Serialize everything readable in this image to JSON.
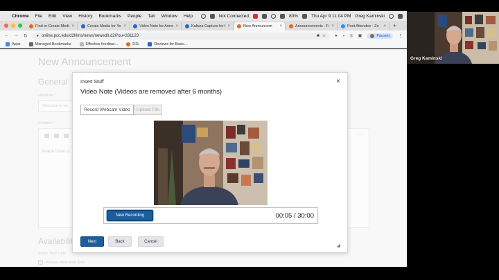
{
  "menubar": {
    "app": "Chrome",
    "items": [
      "File",
      "Edit",
      "View",
      "History",
      "Bookmarks",
      "People",
      "Tab",
      "Window",
      "Help"
    ],
    "status": "Not Connected",
    "battery": "80%",
    "datetime": "Thu Apr 9 11:04 PM",
    "user": "Greg Kaminski"
  },
  "tabs": [
    {
      "title": "Find or Create Media",
      "fav": "#e06a1a",
      "active": false
    },
    {
      "title": "Create Media for Yo",
      "fav": "#2a66c7",
      "active": false
    },
    {
      "title": "Video Note for Anno",
      "fav": "#2a66c7",
      "active": false
    },
    {
      "title": "Kaltura Capture for E",
      "fav": "#2a66c7",
      "active": false
    },
    {
      "title": "New Announcem",
      "fav": "#e06a1a",
      "active": true
    },
    {
      "title": "Announcements - Fa",
      "fav": "#e06a1a",
      "active": false
    },
    {
      "title": "Post Attendee - Zo",
      "fav": "#2d8cff",
      "active": false
    }
  ],
  "toolbar": {
    "url": "online.pcc.edu/d2l/lms/news/newedit.d2l?ou=331123",
    "profile": "Paused"
  },
  "bookmarks": [
    "Apps",
    "Managed Bookmarks",
    "Effective feedbac...",
    "D2L",
    "Reviews for Basic..."
  ],
  "page": {
    "title": "New Announcement",
    "general": "General",
    "headline_label": "Headline *",
    "headline_value": "Welcome to we",
    "content_label": "Content *",
    "content_placeholder": "Please listen to",
    "availability": "Availability",
    "start_label": "Show Start Date",
    "always_show": "Always show start date"
  },
  "dialog": {
    "title": "Insert Stuff",
    "subtitle": "Video Note (Videos are removed after 6 months)",
    "tab_record": "Record Webcam Video",
    "tab_upload": "Upload File",
    "new_recording": "New Recording",
    "timer": "00:05 / 30:00",
    "next": "Next",
    "back": "Back",
    "cancel": "Cancel"
  },
  "zoom": {
    "participant": "Greg Kaminski"
  }
}
